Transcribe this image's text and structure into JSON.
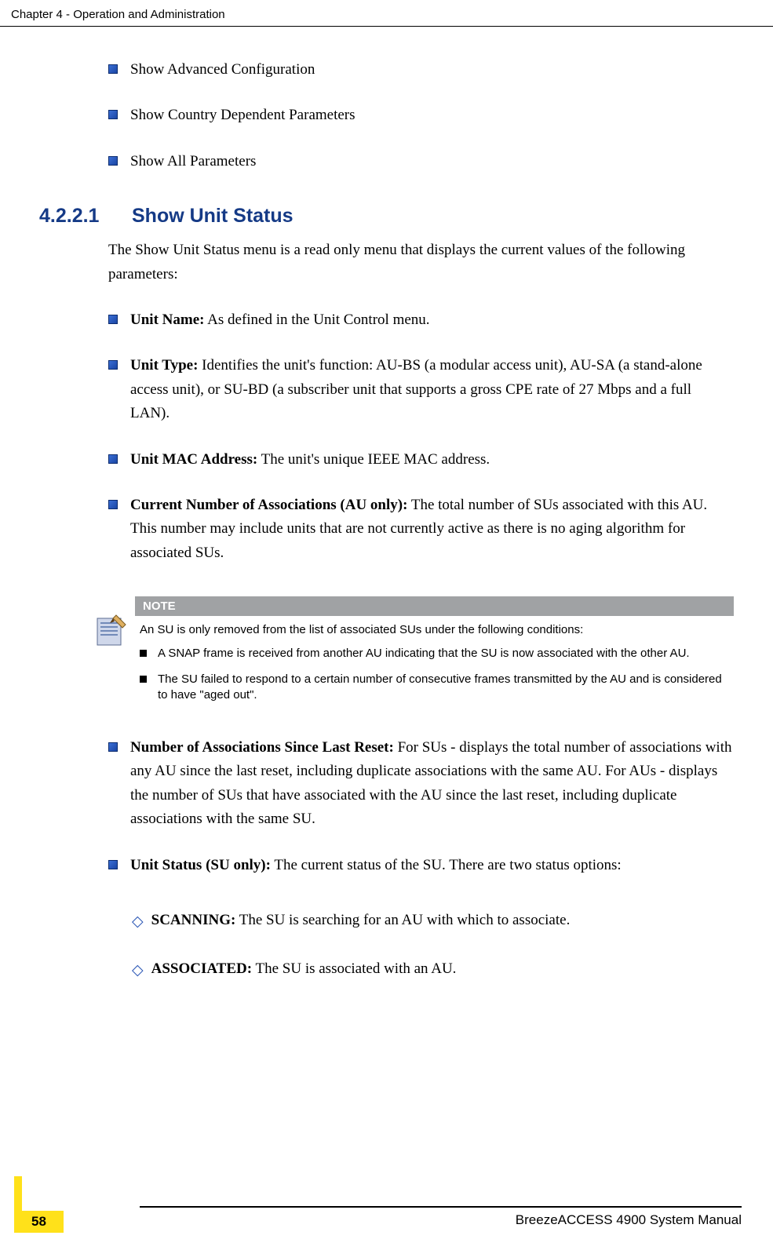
{
  "header": {
    "chapter_line": "Chapter 4 - Operation and Administration"
  },
  "intro_bullets": [
    {
      "text": "Show Advanced Configuration"
    },
    {
      "text": "Show Country Dependent Parameters"
    },
    {
      "text": "Show All Parameters"
    }
  ],
  "section": {
    "number": "4.2.2.1",
    "title": "Show Unit Status",
    "intro": "The Show Unit Status menu is a read only menu that displays the current values of the following parameters:"
  },
  "items_before_note": [
    {
      "bold": "Unit Name:",
      "text": " As defined in the Unit Control menu."
    },
    {
      "bold": "Unit Type:",
      "text": " Identifies the unit's function: AU-BS (a modular access unit), AU-SA (a stand-alone access unit), or SU-BD (a subscriber unit that supports a gross CPE rate of 27 Mbps and a full LAN)."
    },
    {
      "bold": "Unit MAC Address:",
      "text": " The unit's unique IEEE MAC address."
    },
    {
      "bold": "Current Number of Associations (AU only):",
      "text": " The total number of SUs associated with this AU. This number may include units that are not currently active as there is no aging algorithm for associated SUs."
    }
  ],
  "note": {
    "header": "NOTE",
    "intro": "An SU is only removed from the list of associated SUs under the following conditions:",
    "bullets": [
      "A SNAP frame is received from another AU indicating that the SU is now associated with the other AU.",
      "The SU failed to respond to a certain number of consecutive frames transmitted by the AU and is considered to have \"aged out\"."
    ]
  },
  "items_after_note": [
    {
      "bold": "Number of Associations Since Last Reset:",
      "text": " For SUs - displays the total number of associations with any AU since the last reset, including duplicate associations with the same AU. For AUs - displays the number of SUs that have associated with the AU since the last reset, including duplicate associations with the same SU."
    },
    {
      "bold": "Unit Status (SU only):",
      "text": " The current status of the SU. There are two status options:"
    }
  ],
  "status_options": [
    {
      "bold": "SCANNING:",
      "text": " The SU is searching for an AU with which to associate."
    },
    {
      "bold": "ASSOCIATED:",
      "text": " The SU is associated with an AU."
    }
  ],
  "footer": {
    "manual_title": "BreezeACCESS 4900 System Manual",
    "page_number": "58"
  }
}
